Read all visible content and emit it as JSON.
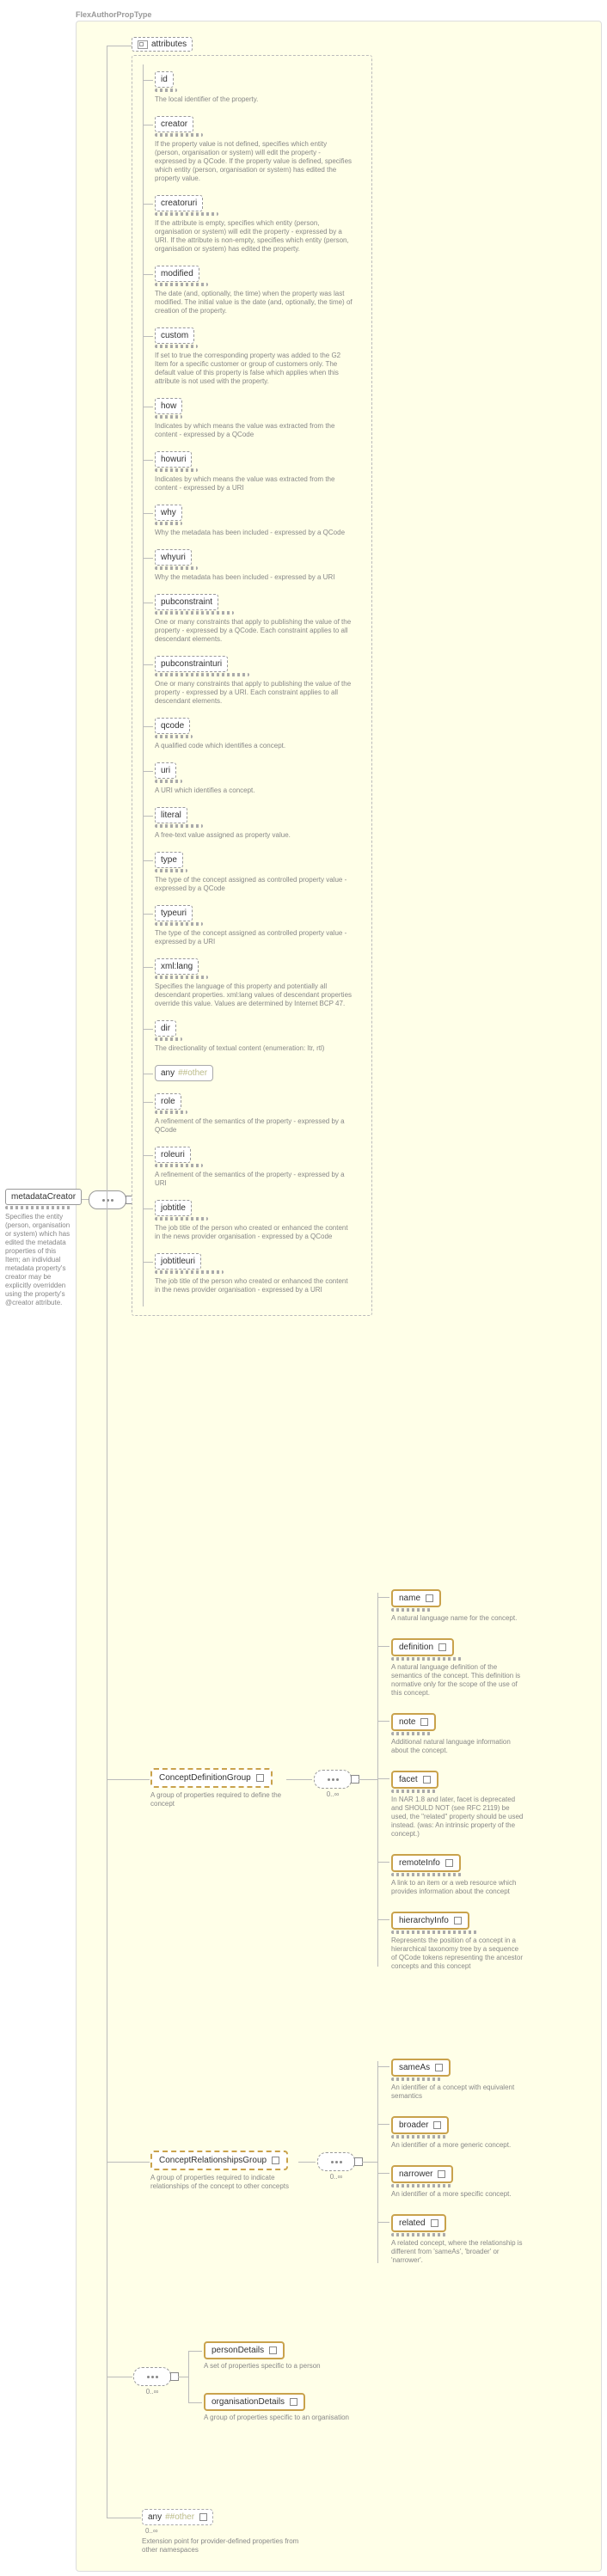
{
  "diagram_title": "FlexAuthorPropType",
  "root": {
    "name": "metadataCreator",
    "desc": "Specifies the entity (person, organisation or system) which has edited the metadata properties of this Item; an individual metadata property's creator may be explicitly overridden using the property's @creator attribute."
  },
  "attributes_label": "attributes",
  "attributes": [
    {
      "name": "id",
      "desc": "The local identifier of the property."
    },
    {
      "name": "creator",
      "desc": "If the property value is not defined, specifies which entity (person, organisation or system) will edit the property - expressed by a QCode. If the property value is defined, specifies which entity (person, organisation or system) has edited the property value."
    },
    {
      "name": "creatoruri",
      "desc": "If the attribute is empty, specifies which entity (person, organisation or system) will edit the property - expressed by a URI. If the attribute is non-empty, specifies which entity (person, organisation or system) has edited the property."
    },
    {
      "name": "modified",
      "desc": "The date (and, optionally, the time) when the property was last modified. The initial value is the date (and, optionally, the time) of creation of the property."
    },
    {
      "name": "custom",
      "desc": "If set to true the corresponding property was added to the G2 Item for a specific customer or group of customers only. The default value of this property is false which applies when this attribute is not used with the property."
    },
    {
      "name": "how",
      "desc": "Indicates by which means the value was extracted from the content - expressed by a QCode"
    },
    {
      "name": "howuri",
      "desc": "Indicates by which means the value was extracted from the content - expressed by a URI"
    },
    {
      "name": "why",
      "desc": "Why the metadata has been included - expressed by a QCode"
    },
    {
      "name": "whyuri",
      "desc": "Why the metadata has been included - expressed by a URI"
    },
    {
      "name": "pubconstraint",
      "desc": "One or many constraints that apply to publishing the value of the property - expressed by a QCode. Each constraint applies to all descendant elements."
    },
    {
      "name": "pubconstrainturi",
      "desc": "One or many constraints that apply to publishing the value of the property - expressed by a URI. Each constraint applies to all descendant elements."
    },
    {
      "name": "qcode",
      "desc": "A qualified code which identifies a concept."
    },
    {
      "name": "uri",
      "desc": "A URI which identifies a concept."
    },
    {
      "name": "literal",
      "desc": "A free-text value assigned as property value."
    },
    {
      "name": "type",
      "desc": "The type of the concept assigned as controlled property value - expressed by a QCode"
    },
    {
      "name": "typeuri",
      "desc": "The type of the concept assigned as controlled property value - expressed by a URI"
    },
    {
      "name": "xml:lang",
      "desc": "Specifies the language of this property and potentially all descendant properties. xml:lang values of descendant properties override this value. Values are determined by Internet BCP 47."
    },
    {
      "name": "dir",
      "desc": "The directionality of textual content (enumeration: ltr, rtl)"
    },
    {
      "name": "any",
      "hash": "##other",
      "desc": ""
    },
    {
      "name": "role",
      "desc": "A refinement of the semantics of the property - expressed by a QCode"
    },
    {
      "name": "roleuri",
      "desc": "A refinement of the semantics of the property - expressed by a URI"
    },
    {
      "name": "jobtitle",
      "desc": "The job title of the person who created or enhanced the content in the news provider organisation - expressed by a QCode"
    },
    {
      "name": "jobtitleuri",
      "desc": "The job title of the person who created or enhanced the content in the news provider organisation - expressed by a URI"
    }
  ],
  "concept_def": {
    "name": "ConceptDefinitionGroup",
    "desc": "A group of properties required to define the concept",
    "card": "0..∞",
    "children": [
      {
        "name": "name",
        "desc": "A natural language name for the concept.",
        "req": true
      },
      {
        "name": "definition",
        "desc": "A natural language definition of the semantics of the concept. This definition is normative only for the scope of the use of this concept.",
        "req": true
      },
      {
        "name": "note",
        "desc": "Additional natural language information about the concept.",
        "req": true
      },
      {
        "name": "facet",
        "desc": "In NAR 1.8 and later, facet is deprecated and SHOULD NOT (see RFC 2119) be used, the \"related\" property should be used instead. (was: An intrinsic property of the concept.)",
        "req": true
      },
      {
        "name": "remoteInfo",
        "desc": "A link to an item or a web resource which provides information about the concept",
        "req": true
      },
      {
        "name": "hierarchyInfo",
        "desc": "Represents the position of a concept in a hierarchical taxonomy tree by a sequence of QCode tokens representing the ancestor concepts and this concept",
        "req": true
      }
    ]
  },
  "concept_rel": {
    "name": "ConceptRelationshipsGroup",
    "desc": "A group of properties required to indicate relationships of the concept to other concepts",
    "card": "0..∞",
    "children": [
      {
        "name": "sameAs",
        "desc": "An identifier of a concept with equivalent semantics",
        "req": true
      },
      {
        "name": "broader",
        "desc": "An identifier of a more generic concept.",
        "req": true
      },
      {
        "name": "narrower",
        "desc": "An identifier of a more specific concept.",
        "req": true
      },
      {
        "name": "related",
        "desc": "A related concept, where the relationship is different from 'sameAs', 'broader' or 'narrower'.",
        "req": true
      }
    ]
  },
  "entity": {
    "card": "0..∞",
    "person": {
      "name": "personDetails",
      "desc": "A set of properties specific to a person"
    },
    "org": {
      "name": "organisationDetails",
      "desc": "A group of properties specific to an organisation"
    }
  },
  "extension": {
    "any_label": "any",
    "hash": "##other",
    "card": "0..∞",
    "desc": "Extension point for provider-defined properties from other namespaces"
  }
}
